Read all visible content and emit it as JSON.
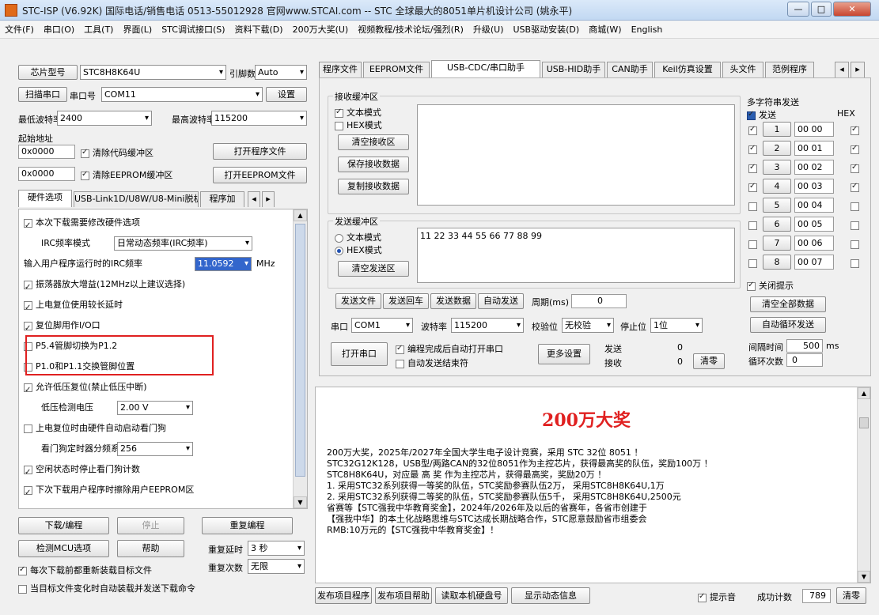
{
  "window": {
    "title": "STC-ISP (V6.92K) 国际电话/销售电话 0513-55012928 官网www.STCAI.com  -- STC 全球最大的8051单片机设计公司 (姚永平)",
    "min": "—",
    "max": "□",
    "close": "✕"
  },
  "menu": [
    "文件(F)",
    "串口(O)",
    "工具(T)",
    "界面(L)",
    "STC调试接口(S)",
    "资料下载(D)",
    "200万大奖(U)",
    "视频教程/技术论坛/强烈(R)",
    "升级(U)",
    "USB驱动安装(D)",
    "商城(W)",
    "English"
  ],
  "left": {
    "chip_btn": "芯片型号",
    "chip_value": "STC8H8K64U",
    "pins_label": "引脚数",
    "pins_value": "Auto",
    "scan_btn": "扫描串口",
    "port_label": "串口号",
    "port_value": "COM11",
    "settings_btn": "设置",
    "min_baud_label": "最低波特率",
    "min_baud": "2400",
    "max_baud_label": "最高波特率",
    "max_baud": "115200",
    "start_addr_label": "起始地址",
    "addr1": "0x0000",
    "clear_code": "清除代码缓冲区",
    "open_prog_btn": "打开程序文件",
    "addr2": "0x0000",
    "clear_eeprom": "清除EEPROM缓冲区",
    "open_eeprom_btn": "打开EEPROM文件",
    "tabs": [
      "硬件选项",
      "USB-Link1D/U8W/U8-Mini脱机",
      "程序加"
    ],
    "options": [
      {
        "text": "本次下载需要修改硬件选项",
        "checked": true
      },
      {
        "text": "IRC频率模式",
        "combo": "日常动态频率(IRC频率)",
        "type": "combo"
      },
      {
        "text": "输入用户程序运行时的IRC频率",
        "combo": "11.0592",
        "unit": "MHz",
        "type": "freq"
      },
      {
        "text": "振荡器放大增益(12MHz以上建议选择)",
        "checked": true
      },
      {
        "text": "上电复位使用较长延时",
        "checked": true
      },
      {
        "text": "复位脚用作I/O口",
        "checked": true
      },
      {
        "text": "P5.4管脚切换为P1.2",
        "checked": false
      },
      {
        "text": "P1.0和P1.1交换管脚位置",
        "checked": false
      },
      {
        "text": "允许低压复位(禁止低压中断)",
        "checked": true
      },
      {
        "text": "低压检测电压",
        "combo": "2.00 V",
        "type": "indent"
      },
      {
        "text": "上电复位时由硬件自动启动看门狗",
        "checked": false
      },
      {
        "text": "看门狗定时器分频系数",
        "combo": "256",
        "type": "indent"
      },
      {
        "text": "空闲状态时停止看门狗计数",
        "checked": true
      },
      {
        "text": "下次下载用户程序时擦除用户EEPROM区",
        "checked": true
      }
    ],
    "download_btn": "下载/编程",
    "stop_btn": "停止",
    "reprogram_btn": "重复编程",
    "check_mcu_btn": "检测MCU选项",
    "help_btn": "帮助",
    "repeat_delay_label": "重复延时",
    "repeat_delay": "3 秒",
    "reload_label": "每次下载前都重新装载目标文件",
    "repeat_count_label": "重复次数",
    "repeat_count": "无限",
    "auto_send_label": "当目标文件变化时自动装载并发送下载命令"
  },
  "right": {
    "tabs": [
      "程序文件",
      "EEPROM文件",
      "USB-CDC/串口助手",
      "USB-HID助手",
      "CAN助手",
      "Keil仿真设置",
      "头文件",
      "范例程序"
    ],
    "recv": {
      "title": "接收缓冲区",
      "text_mode": "文本模式",
      "hex_mode": "HEX模式",
      "clear_btn": "清空接收区",
      "save_btn": "保存接收数据",
      "copy_btn": "复制接收数据"
    },
    "send": {
      "title": "发送缓冲区",
      "text_mode": "文本模式",
      "hex_mode": "HEX模式",
      "clear_btn": "清空发送区",
      "data": "11 22 33 44 55 66 77 88 99"
    },
    "buttons": [
      "发送文件",
      "发送回车",
      "发送数据",
      "自动发送"
    ],
    "period_label": "周期(ms)",
    "period_value": "0",
    "port_label": "串口",
    "port": "COM1",
    "baud_label": "波特率",
    "baud": "115200",
    "parity_label": "校验位",
    "parity": "无校验",
    "stop_label": "停止位",
    "stop": "1位",
    "open_port_btn": "打开串口",
    "chk_auto_open": "编程完成后自动打开串口",
    "chk_auto_send": "自动发送结束符",
    "more_btn": "更多设置",
    "sent_label": "发送",
    "sent_value": "0",
    "recv_label": "接收",
    "recv_value": "0",
    "clear_count_btn": "清零",
    "multi": {
      "title": "多字符串发送",
      "send_col": "发送",
      "hex_col": "HEX",
      "rows": [
        {
          "n": "1",
          "v": "00 00",
          "hex": true,
          "chk": true
        },
        {
          "n": "2",
          "v": "00 01",
          "hex": true,
          "chk": true
        },
        {
          "n": "3",
          "v": "00 02",
          "hex": true,
          "chk": true
        },
        {
          "n": "4",
          "v": "00 03",
          "hex": true,
          "chk": true
        },
        {
          "n": "5",
          "v": "00 04",
          "hex": false,
          "chk": false
        },
        {
          "n": "6",
          "v": "00 05",
          "hex": false,
          "chk": false
        },
        {
          "n": "7",
          "v": "00 06",
          "hex": false,
          "chk": false
        },
        {
          "n": "8",
          "v": "00 07",
          "hex": false,
          "chk": false
        }
      ],
      "close_hint": "关闭提示",
      "clear_all_btn": "清空全部数据",
      "auto_loop_btn": "自动循环发送",
      "interval_label": "间隔时间",
      "interval": "500",
      "interval_unit": "ms",
      "loop_label": "循环次数",
      "loop": "0"
    }
  },
  "ad": {
    "title": "200万大奖",
    "lines": [
      "200万大奖，2025年/2027年全国大学生电子设计竞赛，采用 STC 32位 8051 ！",
      "STC32G12K128，USB型/两路CAN的32位8051作为主控芯片，获得最高奖的队伍，奖励100万 ！",
      "STC8H8K64U，对应最  高  奖  作为主控芯片，获得最高奖，奖励20万 ！",
      "1. 采用STC32系列获得一等奖的队伍，STC奖励参赛队伍2万， 采用STC8H8K64U,1万",
      "2. 采用STC32系列获得二等奖的队伍，STC奖励参赛队伍5千， 采用STC8H8K64U,2500元",
      "省赛等【STC强我中华教育奖金】，2024年/2026年及以后的省赛年，各省市创建于",
      "【强我中华】的本土化战略思维与STC达成长期战略合作，STC愿意鼓励省市组委会",
      "RMB:10万元的【STC强我中华教育奖金】！"
    ]
  },
  "bottom": {
    "buttons": [
      "发布项目程序",
      "发布项目帮助",
      "读取本机硬盘号",
      "显示动态信息"
    ],
    "hint_label": "提示音",
    "success_label": "成功计数",
    "success_value": "789",
    "clear_btn": "清零"
  }
}
